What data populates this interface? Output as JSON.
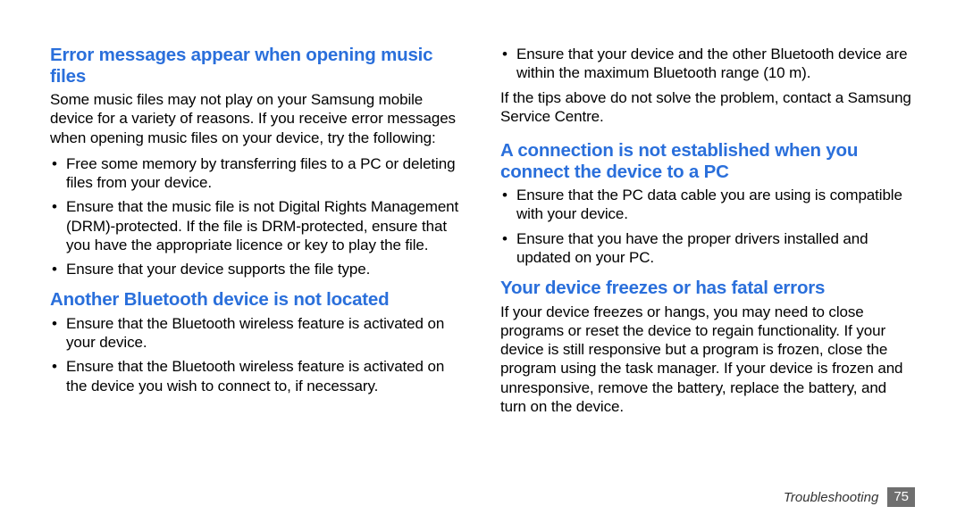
{
  "left": {
    "section1": {
      "heading": "Error messages appear when opening music files",
      "para": "Some music files may not play on your Samsung mobile device for a variety of reasons. If you receive error messages when opening music files on your device, try the following:",
      "bullets": [
        "Free some memory by transferring files to a PC or deleting files from your device.",
        "Ensure that the music file is not Digital Rights Management (DRM)-protected. If the file is DRM-protected, ensure that you have the appropriate licence or key to play the file.",
        "Ensure that your device supports the file type."
      ]
    },
    "section2": {
      "heading": "Another Bluetooth device is not located",
      "bullets": [
        "Ensure that the Bluetooth wireless feature is activated on your device.",
        "Ensure that the Bluetooth wireless feature is activated on the device you wish to connect to, if necessary."
      ]
    }
  },
  "right": {
    "top_bullets": [
      "Ensure that your device and the other Bluetooth device are within the maximum Bluetooth range (10 m)."
    ],
    "top_para": "If the tips above do not solve the problem, contact a Samsung Service Centre.",
    "section1": {
      "heading": "A connection is not established when you connect the device to a PC",
      "bullets": [
        "Ensure that the PC data cable you are using is compatible with your device.",
        "Ensure that you have the proper drivers installed and updated on your PC."
      ]
    },
    "section2": {
      "heading": "Your device freezes or has fatal errors",
      "para": "If your device freezes or hangs, you may need to close programs or reset the device to regain functionality. If your device is still responsive but a program is frozen, close the program using the task manager. If your device is frozen and unresponsive, remove the battery, replace the battery, and turn on the device."
    }
  },
  "footer": {
    "label": "Troubleshooting",
    "page": "75"
  }
}
